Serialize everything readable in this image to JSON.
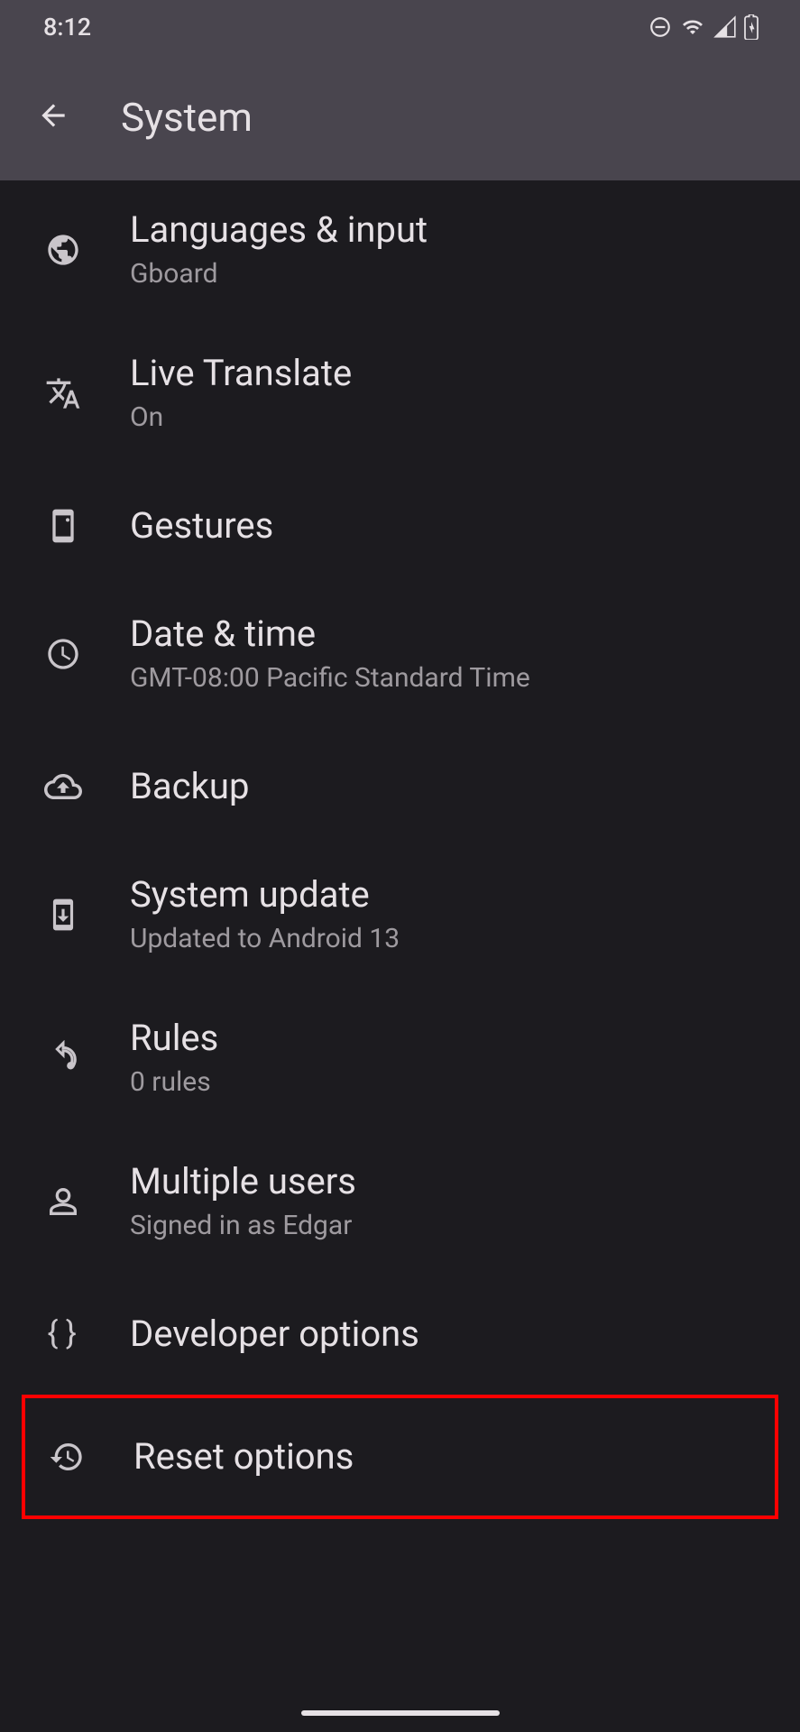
{
  "statusBar": {
    "time": "8:12"
  },
  "appBar": {
    "title": "System"
  },
  "items": [
    {
      "title": "Languages & input",
      "subtitle": "Gboard"
    },
    {
      "title": "Live Translate",
      "subtitle": "On"
    },
    {
      "title": "Gestures",
      "subtitle": ""
    },
    {
      "title": "Date & time",
      "subtitle": "GMT-08:00 Pacific Standard Time"
    },
    {
      "title": "Backup",
      "subtitle": ""
    },
    {
      "title": "System update",
      "subtitle": "Updated to Android 13"
    },
    {
      "title": "Rules",
      "subtitle": "0 rules"
    },
    {
      "title": "Multiple users",
      "subtitle": "Signed in as Edgar"
    },
    {
      "title": "Developer options",
      "subtitle": ""
    },
    {
      "title": "Reset options",
      "subtitle": ""
    }
  ]
}
